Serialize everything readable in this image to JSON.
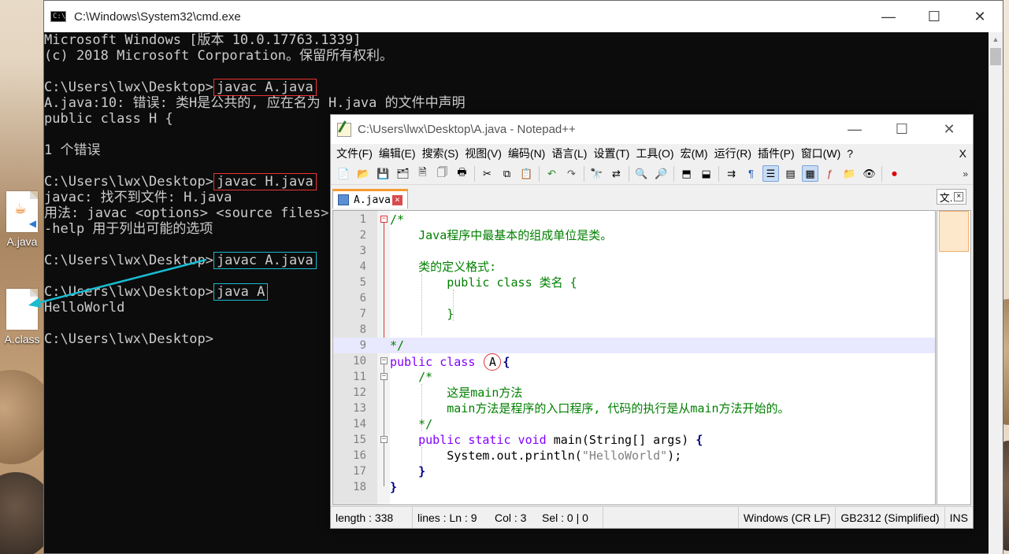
{
  "desktop": {
    "icons": [
      {
        "label": "A.java"
      },
      {
        "label": "A.class"
      }
    ]
  },
  "cmd": {
    "title": "C:\\Windows\\System32\\cmd.exe",
    "lines": [
      {
        "prefix": "Microsoft Windows [版本 10.0.17763.1339]",
        "cmd": "",
        "box": ""
      },
      {
        "prefix": "(c) 2018 Microsoft Corporation。保留所有权利。",
        "cmd": "",
        "box": ""
      },
      {
        "prefix": "",
        "cmd": "",
        "box": ""
      },
      {
        "prefix": "C:\\Users\\lwx\\Desktop>",
        "cmd": "javac A.java",
        "box": "red"
      },
      {
        "prefix": "A.java:10: 错误: 类H是公共的, 应在名为 H.java 的文件中声明",
        "cmd": "",
        "box": ""
      },
      {
        "prefix": "public class H {",
        "cmd": "",
        "box": ""
      },
      {
        "prefix": "",
        "cmd": "",
        "box": ""
      },
      {
        "prefix": "1 个错误",
        "cmd": "",
        "box": ""
      },
      {
        "prefix": "",
        "cmd": "",
        "box": ""
      },
      {
        "prefix": "C:\\Users\\lwx\\Desktop>",
        "cmd": "javac H.java",
        "box": "red"
      },
      {
        "prefix": "javac: 找不到文件: H.java",
        "cmd": "",
        "box": ""
      },
      {
        "prefix": "用法: javac <options> <source files>",
        "cmd": "",
        "box": ""
      },
      {
        "prefix": "-help 用于列出可能的选项",
        "cmd": "",
        "box": ""
      },
      {
        "prefix": "",
        "cmd": "",
        "box": ""
      },
      {
        "prefix": "C:\\Users\\lwx\\Desktop>",
        "cmd": "javac A.java",
        "box": "cyan"
      },
      {
        "prefix": "",
        "cmd": "",
        "box": ""
      },
      {
        "prefix": "C:\\Users\\lwx\\Desktop>",
        "cmd": "java A",
        "box": "cyan"
      },
      {
        "prefix": "HelloWorld",
        "cmd": "",
        "box": ""
      },
      {
        "prefix": "",
        "cmd": "",
        "box": ""
      },
      {
        "prefix": "C:\\Users\\lwx\\Desktop>",
        "cmd": "",
        "box": ""
      }
    ]
  },
  "notepad": {
    "title": "C:\\Users\\lwx\\Desktop\\A.java - Notepad++",
    "menu": [
      "文件(F)",
      "编辑(E)",
      "搜索(S)",
      "视图(V)",
      "编码(N)",
      "语言(L)",
      "设置(T)",
      "工具(O)",
      "宏(M)",
      "运行(R)",
      "插件(P)",
      "窗口(W)",
      "?"
    ],
    "menu_close": "X",
    "tab_label": "A.java",
    "docmap_tab": "文.",
    "code": [
      {
        "n": "1"
      },
      {
        "n": "2"
      },
      {
        "n": "3"
      },
      {
        "n": "4"
      },
      {
        "n": "5"
      },
      {
        "n": "6"
      },
      {
        "n": "7"
      },
      {
        "n": "8"
      },
      {
        "n": "9"
      },
      {
        "n": "10"
      },
      {
        "n": "11"
      },
      {
        "n": "12"
      },
      {
        "n": "13"
      },
      {
        "n": "14"
      },
      {
        "n": "15"
      },
      {
        "n": "16"
      },
      {
        "n": "17"
      },
      {
        "n": "18"
      }
    ],
    "code_text": {
      "l1": "/*",
      "l2": "    Java程序中最基本的组成单位是类。",
      "l4": "    类的定义格式:",
      "l5": "        public class 类名 {",
      "l7": "        }",
      "l9": "*/",
      "l10_kw": "public class",
      "l10_name": "A",
      "l10_brace": "{",
      "l11": "    /*",
      "l12": "        这是main方法",
      "l13": "        main方法是程序的入口程序, 代码的执行是从main方法开始的。",
      "l14": "    */",
      "l15_kw": "    public static void",
      "l15_sig": " main(String[] args) ",
      "l15_brace": "{",
      "l16_pre": "        System.out.println(",
      "l16_str": "\"HelloWorld\"",
      "l16_post": ");",
      "l17": "    }",
      "l18": "}"
    },
    "status": {
      "length": "length : 338",
      "lines": "lines : Ln : 9",
      "col": "Col : 3",
      "sel": "Sel : 0 | 0",
      "eol": "Windows (CR LF)",
      "encoding": "GB2312 (Simplified)",
      "mode": "INS"
    }
  },
  "colors": {
    "cmd_bg": "#0c0c0c",
    "cmd_text": "#cccccc",
    "highlight_red": "#e33333",
    "highlight_cyan": "#19bcd1",
    "comment": "#008000",
    "keyword": "#0000ff"
  }
}
